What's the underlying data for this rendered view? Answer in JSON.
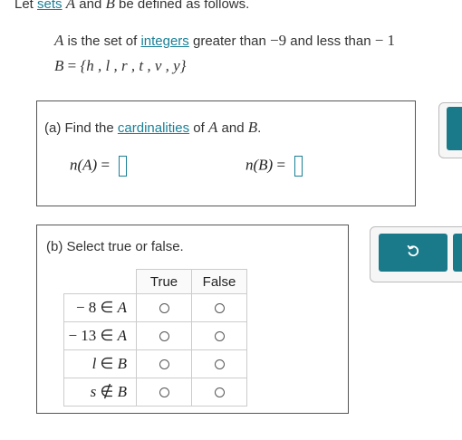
{
  "intro": {
    "prefix": "Let ",
    "link": "sets",
    "var_a": "A",
    "mid": " and ",
    "var_b": "B",
    "suffix": " be defined as follows."
  },
  "setA": {
    "var": "A",
    "text1": " is the set of ",
    "link": "integers",
    "text2": " greater than ",
    "low": "−9",
    "text3": " and less than ",
    "high": "− 1"
  },
  "setB": {
    "var": "B",
    "eq": " = ",
    "elements": "{h , l , r , t , v , y}"
  },
  "part_a": {
    "label": "(a)",
    "text1": " Find the ",
    "link": "cardinalities",
    "text2": " of ",
    "var_a": "A",
    "and": " and ",
    "var_b": "B",
    "period": ".",
    "nA_fn": "n",
    "nA_arg": "(A)",
    "nA_eq": " = ",
    "nB_fn": "n",
    "nB_arg": "(B)",
    "nB_eq": " = "
  },
  "part_b": {
    "label": "(b) Select true or false.",
    "col_true": "True",
    "col_false": "False",
    "rows": [
      {
        "num": "− 8",
        "rel": " ∈ ",
        "set": "A"
      },
      {
        "num": "− 13",
        "rel": " ∈ ",
        "set": "A"
      },
      {
        "num": "l",
        "rel": " ∈ ",
        "set": "B"
      },
      {
        "num": "s",
        "rel": " ∉ ",
        "set": "B"
      }
    ]
  },
  "icons": {
    "undo": "undo-icon"
  },
  "colors": {
    "accent": "#1a7f96",
    "button": "#1a7a8a"
  }
}
